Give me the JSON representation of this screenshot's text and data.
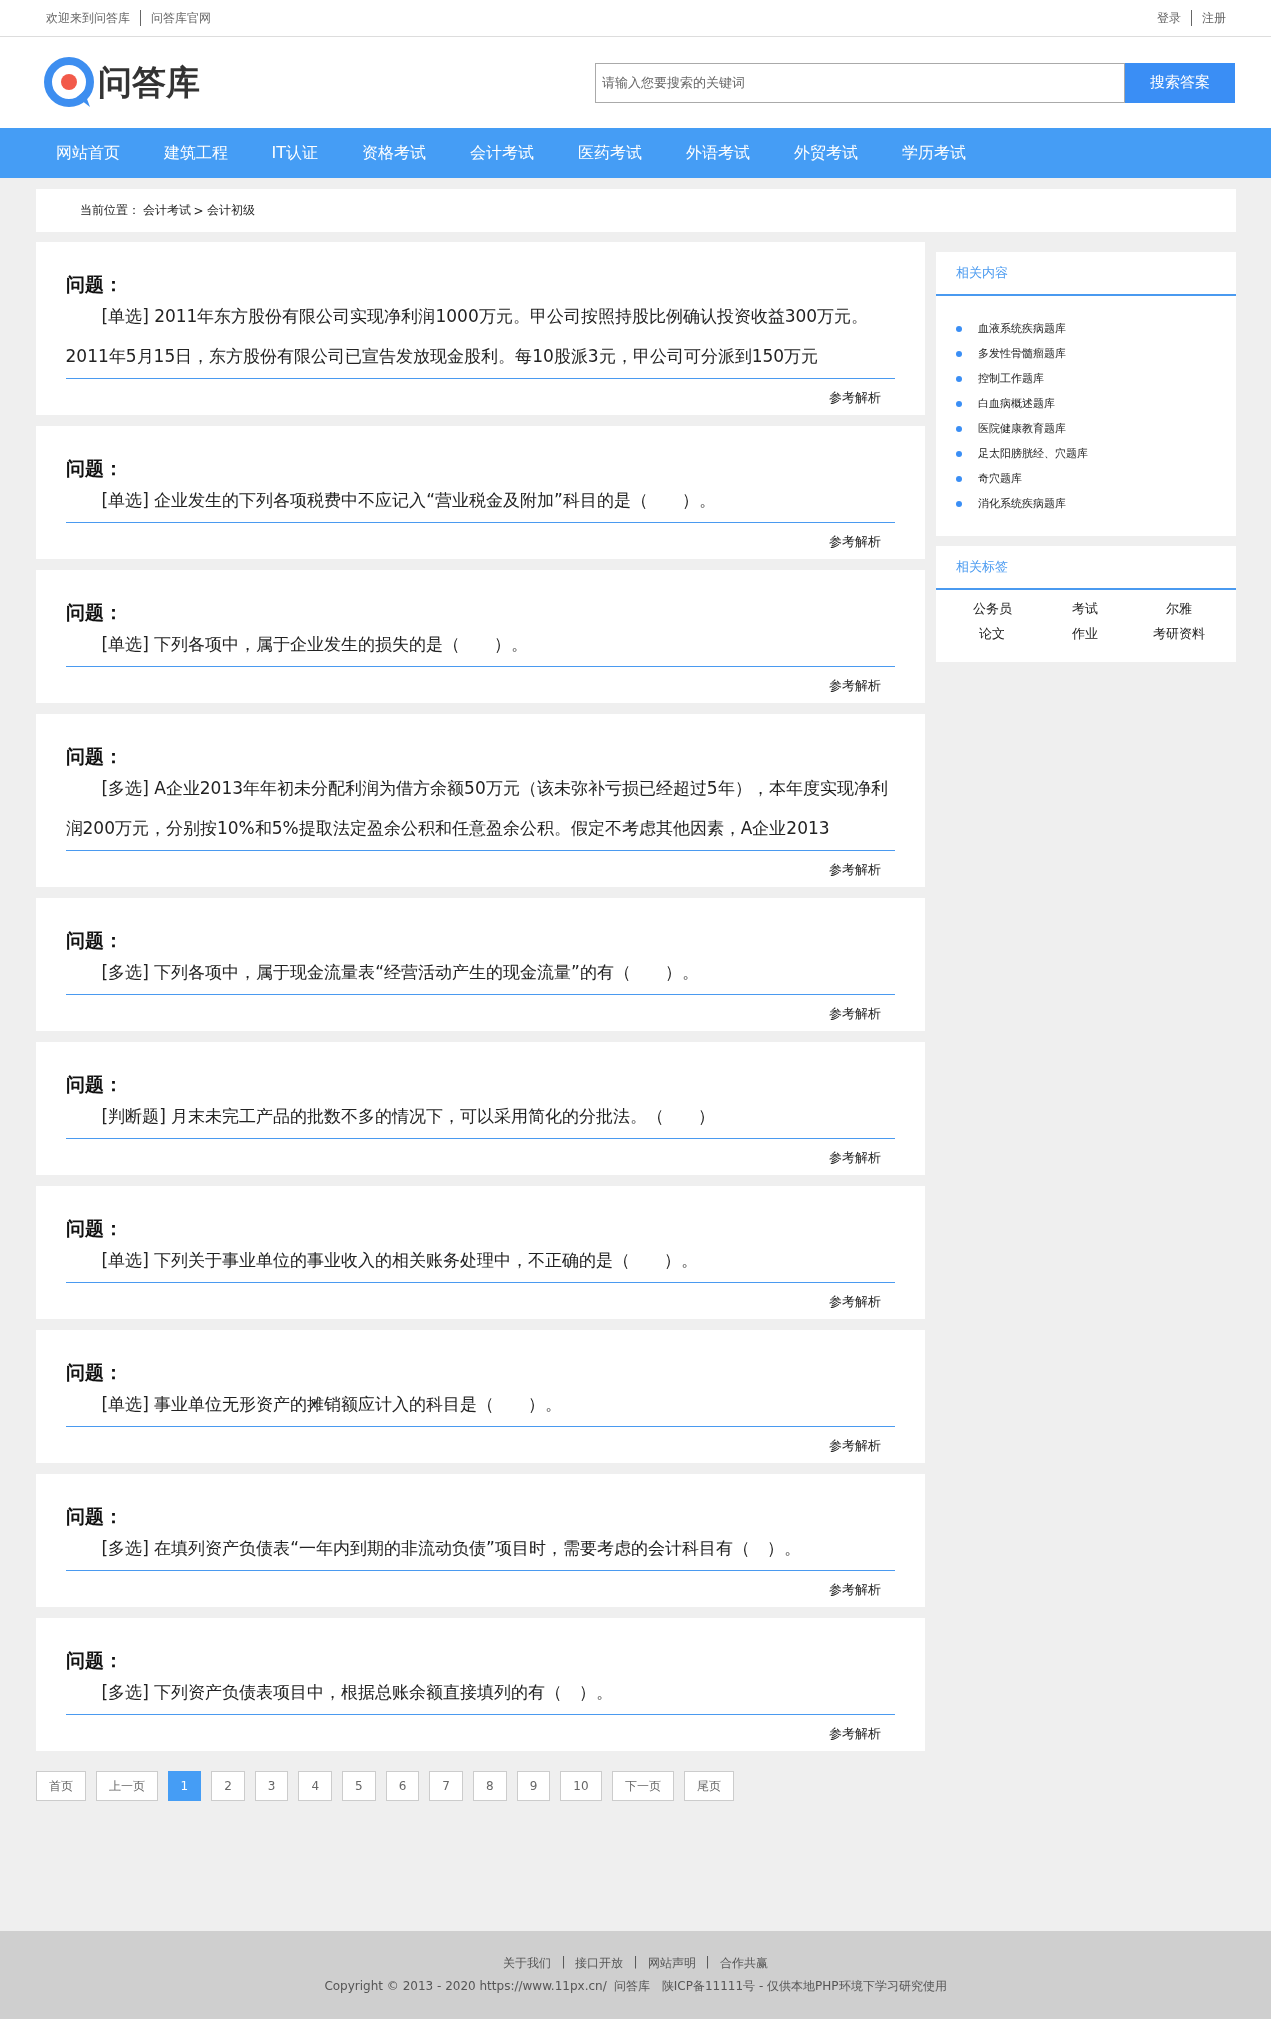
{
  "top_bar": {
    "left_links": [
      "欢迎来到问答库",
      "问答库官网"
    ],
    "right_links": [
      "登录",
      "注册"
    ]
  },
  "header": {
    "logo_text": "问答库",
    "search": {
      "placeholder": "请输入您要搜索的关键词",
      "button": "搜索答案"
    }
  },
  "nav": [
    {
      "label": "网站首页"
    },
    {
      "label": "建筑工程"
    },
    {
      "label": "IT认证"
    },
    {
      "label": "资格考试"
    },
    {
      "label": "会计考试"
    },
    {
      "label": "医药考试"
    },
    {
      "label": "外语考试"
    },
    {
      "label": "外贸考试"
    },
    {
      "label": "学历考试"
    }
  ],
  "breadcrumb": {
    "label": "当前位置：",
    "path": [
      "会计考试",
      "会计初级"
    ],
    "separator": ">"
  },
  "questions": [
    {
      "heading": "问题：",
      "text": "[单选] 2011年东方股份有限公司实现净利润1000万元。甲公司按照持股比例确认投资收益300万元。2011年5月15日，东方股份有限公司已宣告发放现金股利。每10股派3元，甲公司可分派到150万元",
      "link": "参考解析"
    },
    {
      "heading": "问题：",
      "text": "[单选] 企业发生的下列各项税费中不应记入“营业税金及附加”科目的是（　　）。",
      "link": "参考解析"
    },
    {
      "heading": "问题：",
      "text": "[单选] 下列各项中，属于企业发生的损失的是（　　）。",
      "link": "参考解析"
    },
    {
      "heading": "问题：",
      "text": "[多选] A企业2013年年初未分配利润为借方余额50万元（该未弥补亏损已经超过5年），本年度实现净利润200万元，分别按10%和5%提取法定盈余公积和任意盈余公积。假定不考虑其他因素，A企业2013",
      "link": "参考解析"
    },
    {
      "heading": "问题：",
      "text": "[多选] 下列各项中，属于现金流量表“经营活动产生的现金流量”的有（　　）。",
      "link": "参考解析"
    },
    {
      "heading": "问题：",
      "text": "[判断题] 月末未完工产品的批数不多的情况下，可以采用简化的分批法。（　　）",
      "link": "参考解析"
    },
    {
      "heading": "问题：",
      "text": "[单选] 下列关于事业单位的事业收入的相关账务处理中，不正确的是（　　）。",
      "link": "参考解析"
    },
    {
      "heading": "问题：",
      "text": "[单选] 事业单位无形资产的摊销额应计入的科目是（　　）。",
      "link": "参考解析"
    },
    {
      "heading": "问题：",
      "text": "[多选] 在填列资产负债表“一年内到期的非流动负债”项目时，需要考虑的会计科目有（　）。",
      "link": "参考解析"
    },
    {
      "heading": "问题：",
      "text": "[多选] 下列资产负债表项目中，根据总账余额直接填列的有（　）。",
      "link": "参考解析"
    }
  ],
  "pagination": [
    {
      "label": "首页",
      "selected": false
    },
    {
      "label": "上一页",
      "selected": false
    },
    {
      "label": "1",
      "selected": true
    },
    {
      "label": "2",
      "selected": false
    },
    {
      "label": "3",
      "selected": false
    },
    {
      "label": "4",
      "selected": false
    },
    {
      "label": "5",
      "selected": false
    },
    {
      "label": "6",
      "selected": false
    },
    {
      "label": "7",
      "selected": false
    },
    {
      "label": "8",
      "selected": false
    },
    {
      "label": "9",
      "selected": false
    },
    {
      "label": "10",
      "selected": false
    },
    {
      "label": "下一页",
      "selected": false
    },
    {
      "label": "尾页",
      "selected": false
    }
  ],
  "sidebar": {
    "related_content": {
      "title": "相关内容",
      "items": [
        "血液系统疾病题库",
        "多发性骨髓瘤题库",
        "控制工作题库",
        "白血病概述题库",
        "医院健康教育题库",
        "足太阳膀胱经、穴题库",
        "奇穴题库",
        "消化系统疾病题库"
      ]
    },
    "related_tags": {
      "title": "相关标签",
      "tags": [
        "公务员",
        "考试",
        "尔雅",
        "论文",
        "作业",
        "考研资料"
      ]
    }
  },
  "footer": {
    "links": [
      "关于我们",
      "接口开放",
      "网站声明",
      "合作共赢"
    ],
    "separator": "|",
    "copyright": "Copyright © 2013 - 2020 https://www.11px.cn/  问答库   陕ICP备11111号 - 仅供本地PHP环境下学习研究使用"
  }
}
